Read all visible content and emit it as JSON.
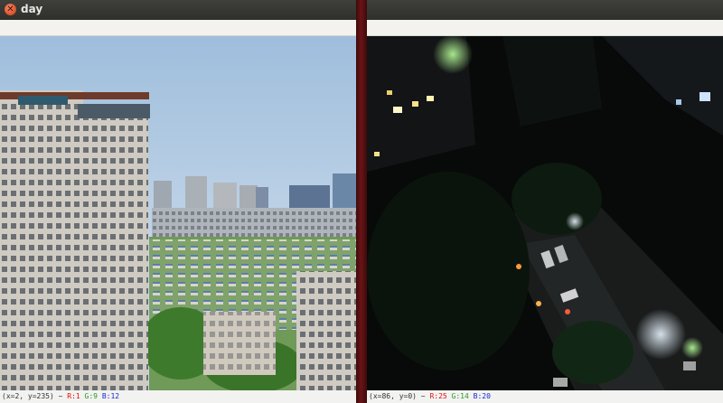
{
  "left_window": {
    "title": "day",
    "status": {
      "coords": "(x=2, y=235) ~",
      "r": "R:1",
      "g": "G:9",
      "b": "B:12"
    }
  },
  "right_window": {
    "title": "",
    "status": {
      "coords": "(x=86, y=0) ~",
      "r": "R:25",
      "g": "G:14",
      "b": "B:20"
    }
  },
  "colors": {
    "desktop_bg": "#5a0f10",
    "titlebar": "#2f2f2c",
    "close_button": "#e0582f",
    "status_r": "#e01010",
    "status_g": "#2a9a2a",
    "status_b": "#1428d8"
  },
  "icons": {
    "close": "close-x-icon"
  }
}
